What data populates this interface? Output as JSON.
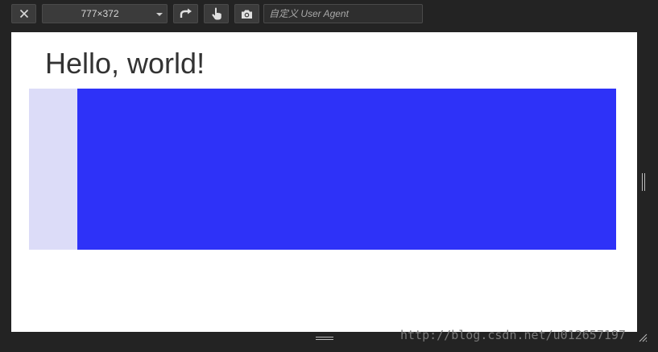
{
  "toolbar": {
    "close_icon": "close-icon",
    "device_size": "777×372",
    "rotate_icon": "rotate-icon",
    "touch_icon": "touch-icon",
    "screenshot_icon": "camera-icon",
    "user_agent_placeholder": "自定义 User Agent"
  },
  "page": {
    "heading": "Hello, world!",
    "outer_box_color": "#dcdcf8",
    "inner_box_color": "#2e32f8"
  },
  "watermark": "http://blog.csdn.net/u012657197"
}
